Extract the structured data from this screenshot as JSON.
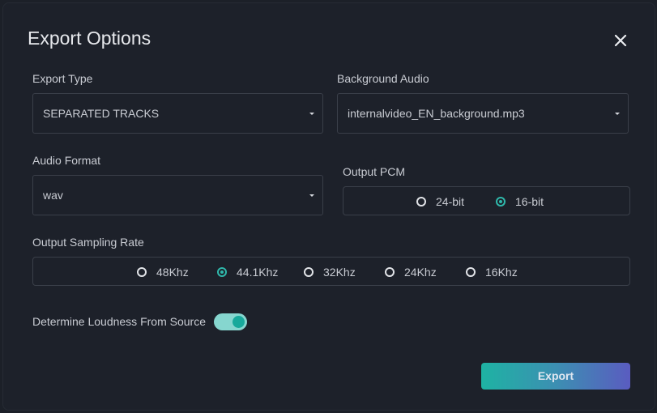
{
  "dialog": {
    "title": "Export Options"
  },
  "export_type": {
    "label": "Export Type",
    "value": "SEPARATED TRACKS"
  },
  "background_audio": {
    "label": "Background Audio",
    "value": "internalvideo_EN_background.mp3"
  },
  "audio_format": {
    "label": "Audio Format",
    "value": "wav"
  },
  "output_pcm": {
    "label": "Output PCM",
    "options": [
      "24-bit",
      "16-bit"
    ],
    "selected": "16-bit"
  },
  "sampling_rate": {
    "label": "Output Sampling Rate",
    "options": [
      "48Khz",
      "44.1Khz",
      "32Khz",
      "24Khz",
      "16Khz"
    ],
    "selected": "44.1Khz"
  },
  "loudness": {
    "label": "Determine Loudness From Source",
    "enabled": true
  },
  "actions": {
    "export_label": "Export"
  },
  "colors": {
    "accent": "#2fb8ab",
    "toggle_track": "#86d6cf",
    "button_gradient_start": "#1eb3a3",
    "button_gradient_end": "#5a5cc0"
  },
  "icons": {
    "close": "close-icon",
    "caret": "caret-down-icon"
  }
}
